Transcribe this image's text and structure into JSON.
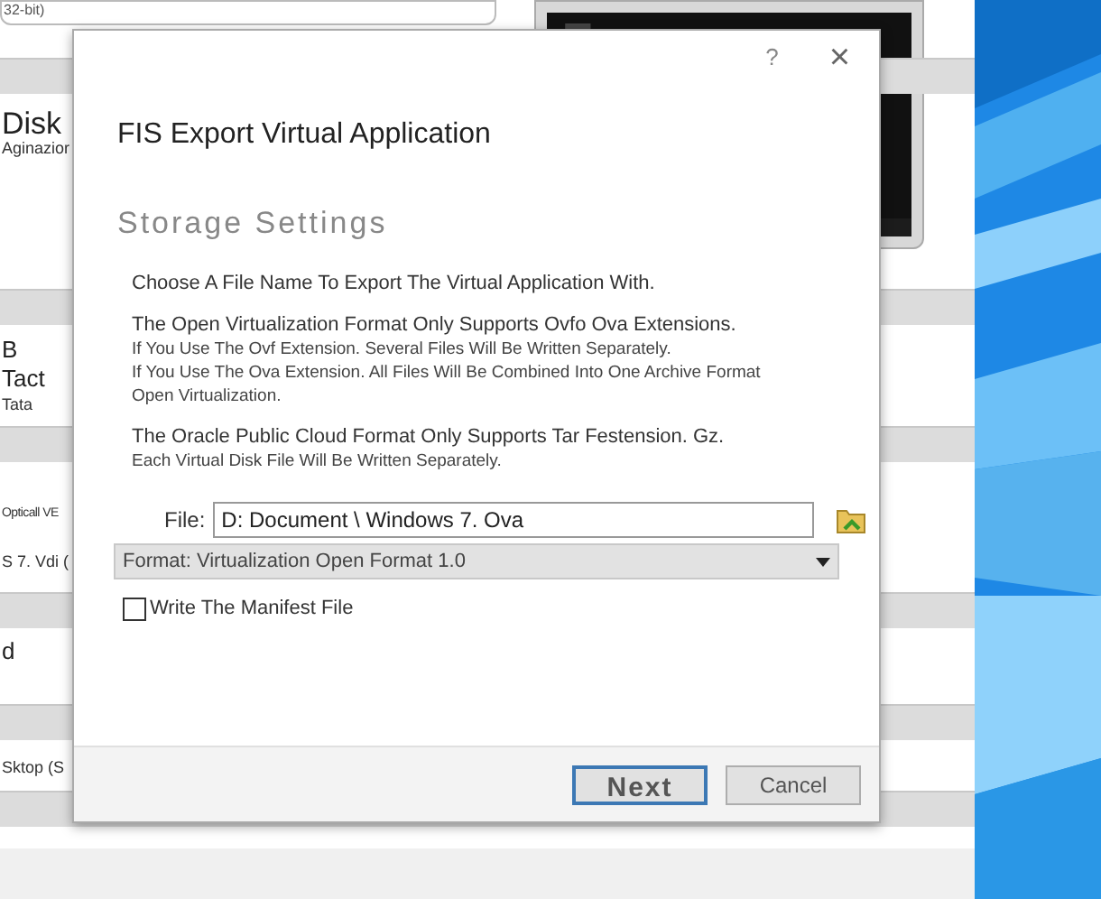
{
  "background_window": {
    "header_text": "32-bit)",
    "strip_texts": [
      {
        "text": "Disk",
        "kind": "large"
      },
      {
        "text": "Aginazior",
        "kind": "small"
      },
      {
        "text": "B",
        "kind": "normal"
      },
      {
        "text": "Tact",
        "kind": "normal"
      },
      {
        "text": "Tata",
        "kind": "small"
      },
      {
        "text": "Opticall VE",
        "kind": "tiny"
      },
      {
        "text": "S 7. Vdi (",
        "kind": "small"
      },
      {
        "text": "d",
        "kind": "normal"
      },
      {
        "text": "Sktop (S",
        "kind": "small"
      }
    ]
  },
  "dialog": {
    "help": "?",
    "close": "×",
    "title": "FIS Export Virtual Application",
    "heading": "Storage Settings",
    "paragraphs": [
      [
        "Choose A File Name To Export The Virtual Application With."
      ],
      [
        "The Open Virtualization Format Only Supports Ovfo Ova Extensions.",
        "If You Use The Ovf Extension. Several Files Will Be Written Separately.",
        "If You Use The Ova Extension. All Files Will Be Combined Into One Archive Format",
        "Open Virtualization."
      ],
      [
        "The Oracle Public Cloud Format Only Supports Tar Festension. Gz.",
        "Each Virtual Disk File Will Be Written Separately."
      ]
    ],
    "file": {
      "label": "File:",
      "value": "D: Document \\ Windows 7. Ova"
    },
    "format": {
      "value": "Format: Virtualization Open Format 1.0"
    },
    "manifest": {
      "label": "Write The Manifest File",
      "checked": false
    },
    "buttons": [
      {
        "label": "Next",
        "focused": true
      },
      {
        "label": "Cancel",
        "focused": false
      }
    ]
  }
}
